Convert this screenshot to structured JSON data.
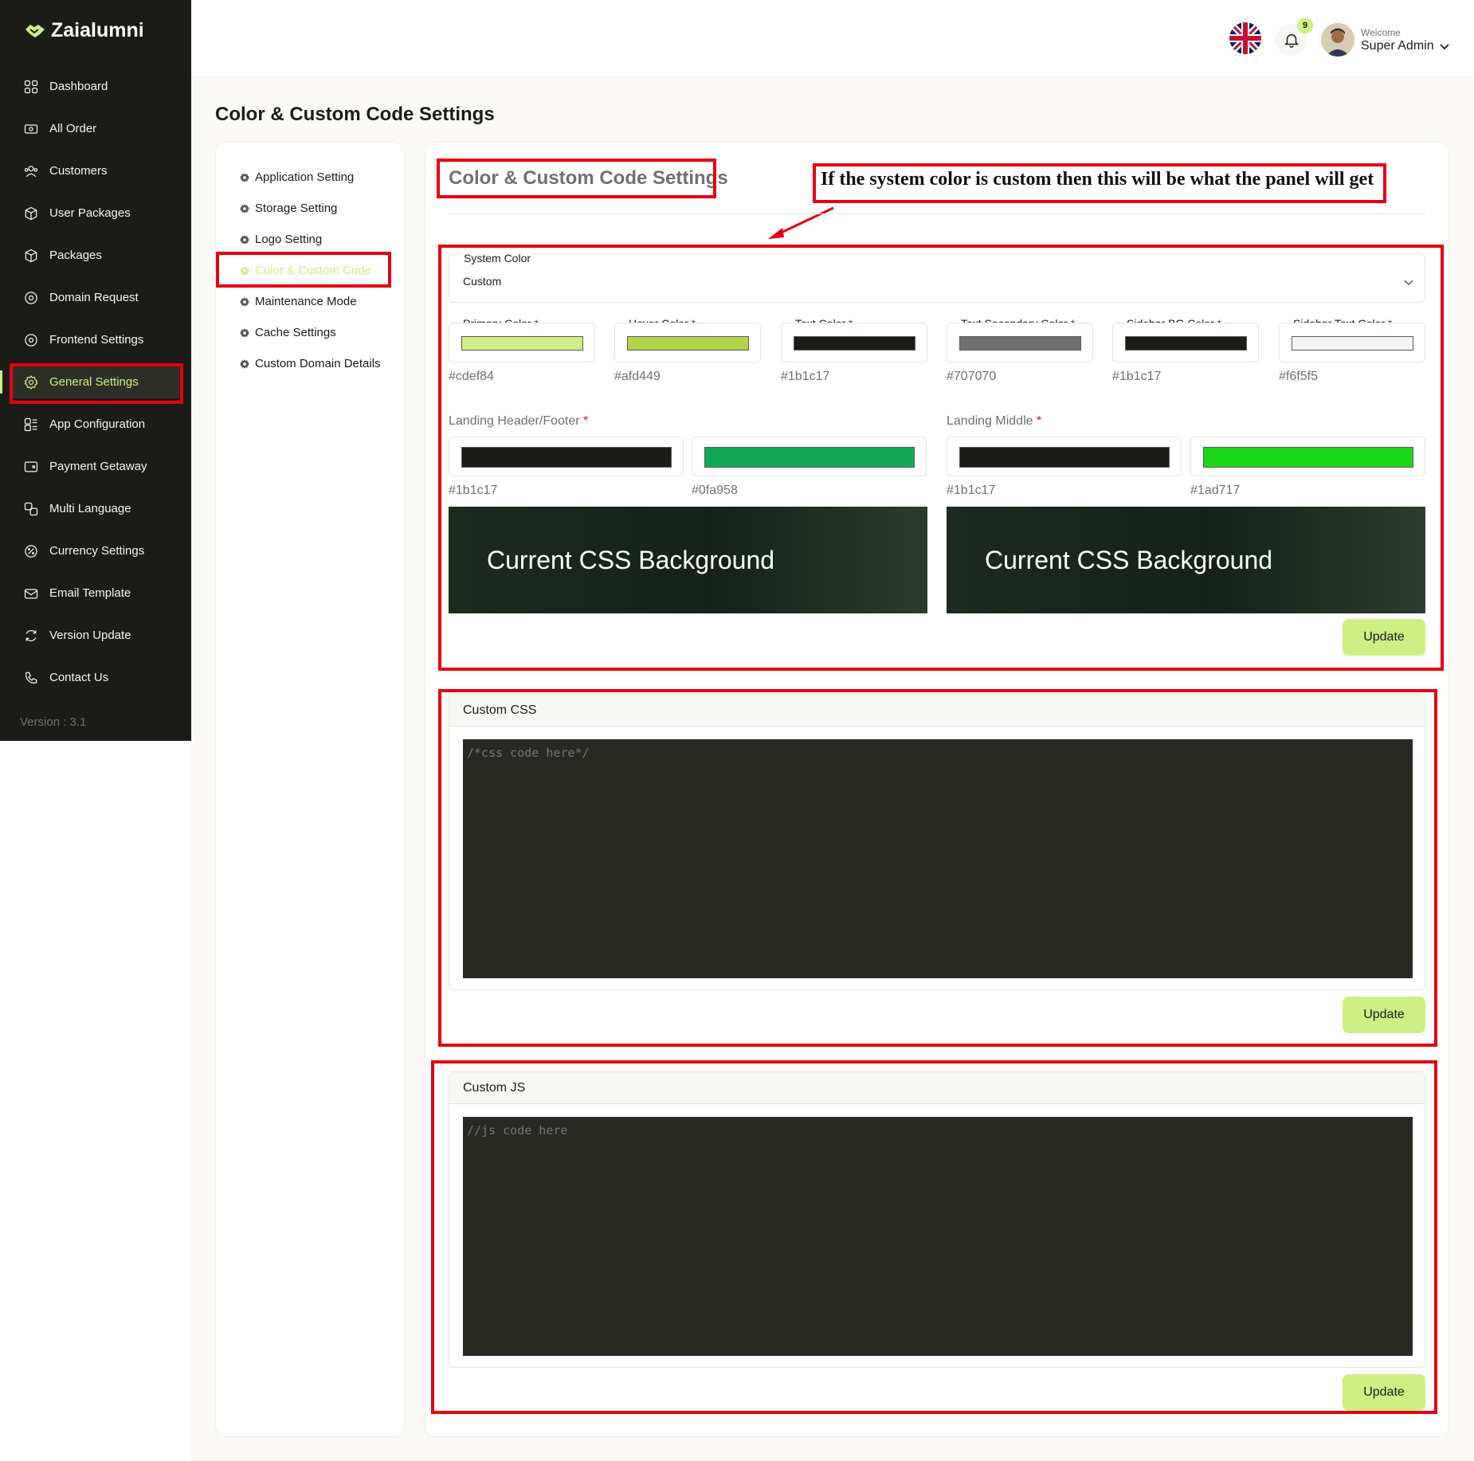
{
  "app": {
    "brand": "Zaialumni",
    "version": "Version : 3.1"
  },
  "sidebar": {
    "items": [
      {
        "label": "Dashboard",
        "icon": "dashboard-icon"
      },
      {
        "label": "All Order",
        "icon": "order-icon"
      },
      {
        "label": "Customers",
        "icon": "customers-icon"
      },
      {
        "label": "User Packages",
        "icon": "package-icon"
      },
      {
        "label": "Packages",
        "icon": "package-icon"
      },
      {
        "label": "Domain Request",
        "icon": "domain-icon"
      },
      {
        "label": "Frontend Settings",
        "icon": "frontend-icon"
      },
      {
        "label": "General Settings",
        "icon": "gear-icon",
        "active": true
      },
      {
        "label": "App Configuration",
        "icon": "app-config-icon"
      },
      {
        "label": "Payment Getaway",
        "icon": "wallet-icon"
      },
      {
        "label": "Multi Language",
        "icon": "language-icon"
      },
      {
        "label": "Currency Settings",
        "icon": "currency-icon"
      },
      {
        "label": "Email Template",
        "icon": "email-icon"
      },
      {
        "label": "Version Update",
        "icon": "refresh-icon"
      },
      {
        "label": "Contact Us",
        "icon": "phone-icon"
      }
    ]
  },
  "topbar": {
    "notification_count": "9",
    "welcome": "Welcome",
    "user_name": "Super Admin"
  },
  "page": {
    "title": "Color & Custom Code Settings"
  },
  "settings_menu": {
    "items": [
      {
        "label": "Application Setting"
      },
      {
        "label": "Storage Setting"
      },
      {
        "label": "Logo Setting"
      },
      {
        "label": "Color & Custom Code",
        "active": true
      },
      {
        "label": "Maintenance Mode"
      },
      {
        "label": "Cache Settings"
      },
      {
        "label": "Custom Domain Details"
      }
    ]
  },
  "panel": {
    "title": "Color & Custom Code Settings",
    "annotation": "If the system color is custom then this will be what the panel will get"
  },
  "system_color": {
    "label": "System Color",
    "value": "Custom"
  },
  "colors": [
    {
      "label": "Primary Color",
      "required": "*",
      "hex": "#cdef84"
    },
    {
      "label": "Hover Color",
      "required": "*",
      "hex": "#afd449"
    },
    {
      "label": "Text Color",
      "required": "*",
      "hex": "#1b1c17"
    },
    {
      "label": "Text Secondary Color",
      "required": "*",
      "hex": "#707070"
    },
    {
      "label": "Sidebar BG Color",
      "required": "*",
      "hex": "#1b1c17"
    },
    {
      "label": "Sidebar Text Color",
      "required": "*",
      "hex": "#f6f5f5"
    }
  ],
  "landing_header_footer": {
    "label": "Landing Header/Footer",
    "required": "*",
    "colors": [
      {
        "hex": "#1b1c17"
      },
      {
        "hex": "#0fa958"
      }
    ],
    "preview_text": "Current CSS Background"
  },
  "landing_middle": {
    "label": "Landing Middle",
    "required": "*",
    "colors": [
      {
        "hex": "#1b1c17"
      },
      {
        "hex": "#1ad717"
      }
    ],
    "preview_text": "Current CSS Background"
  },
  "buttons": {
    "update": "Update"
  },
  "custom_css": {
    "title": "Custom CSS",
    "placeholder": "/*css code here*/"
  },
  "custom_js": {
    "title": "Custom JS",
    "placeholder": "//js code here"
  },
  "theme": {
    "accent": "#cdef84",
    "annotation_red": "#e60012",
    "sidebar_bg": "#1b1c17"
  }
}
